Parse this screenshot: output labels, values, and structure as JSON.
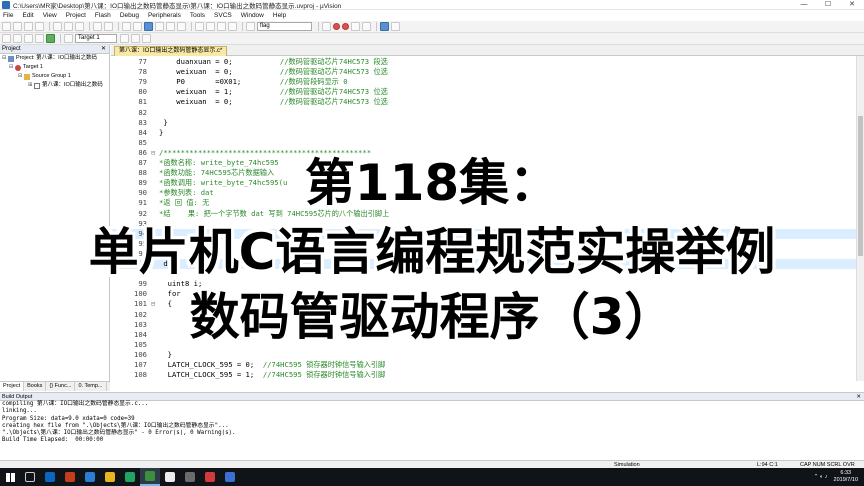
{
  "window": {
    "title": "C:\\Users\\MR家\\Desktop\\第八课：IO口输出之数码管静态显示\\第八课：IO口输出之数码管静态显示.uvproj - µVision"
  },
  "menu": [
    "File",
    "Edit",
    "View",
    "Project",
    "Flash",
    "Debug",
    "Peripherals",
    "Tools",
    "SVCS",
    "Window",
    "Help"
  ],
  "toolbar": {
    "find_text": "flag",
    "target": "Target 1"
  },
  "project": {
    "header": "Project",
    "root": "Project: 第八课：IO口输出之数码",
    "target": "Target 1",
    "group": "Source Group 1",
    "file": "第八课：IO口输出之数码"
  },
  "panel_tabs": [
    "Project",
    "Books",
    "{} Func...",
    "0. Temp..."
  ],
  "editor": {
    "tab": "第八课：IO口输出之数码管静态显示.c*",
    "lines": [
      {
        "n": "77",
        "f": "",
        "code": "    duanxuan = 0;",
        "cmt": "//数码管驱动芯片74HC573 段选"
      },
      {
        "n": "78",
        "f": "",
        "code": "    weixuan  = 0;",
        "cmt": "//数码管驱动芯片74HC573 位选"
      },
      {
        "n": "79",
        "f": "",
        "code": "    P0       =0X01;",
        "cmt": "//数码管段码显示 0"
      },
      {
        "n": "80",
        "f": "",
        "code": "    weixuan  = 1;",
        "cmt": "//数码管驱动芯片74HC573 位选"
      },
      {
        "n": "81",
        "f": "",
        "code": "    weixuan  = 0;",
        "cmt": "//数码管驱动芯片74HC573 位选"
      },
      {
        "n": "82",
        "f": "",
        "code": "",
        "cmt": ""
      },
      {
        "n": "83",
        "f": "",
        "code": " }",
        "cmt": ""
      },
      {
        "n": "84",
        "f": "",
        "code": "}",
        "cmt": ""
      },
      {
        "n": "85",
        "f": "",
        "code": "",
        "cmt": ""
      },
      {
        "n": "86",
        "f": "⊟",
        "code": "",
        "cmt": "/************************************************"
      },
      {
        "n": "87",
        "f": "",
        "code": "",
        "cmt": "*函数名称: write_byte_74hc595"
      },
      {
        "n": "88",
        "f": "",
        "code": "",
        "cmt": "*函数功能: 74HC595芯片数据输入"
      },
      {
        "n": "89",
        "f": "",
        "code": "",
        "cmt": "*函数调用: write_byte_74hc595(u"
      },
      {
        "n": "90",
        "f": "",
        "code": "",
        "cmt": "*参数列表: dat"
      },
      {
        "n": "91",
        "f": "",
        "code": "",
        "cmt": "*返 回 值: 无"
      },
      {
        "n": "92",
        "f": "",
        "code": "",
        "cmt": "*结    果: 把一个字节数 dat 写到 74HC595芯片的八个输出引脚上"
      },
      {
        "n": "93",
        "f": "",
        "code": "",
        "cmt": ""
      },
      {
        "n": "94",
        "f": "",
        "code": "",
        "cmt": ""
      },
      {
        "n": "95",
        "f": "",
        "code": "",
        "cmt": ""
      },
      {
        "n": "96",
        "f": "",
        "code": "",
        "cmt": ""
      },
      {
        "n": "97",
        "f": "",
        "code": " d",
        "cmt": ""
      },
      {
        "n": "98",
        "f": "",
        "code": "",
        "cmt": ""
      },
      {
        "n": "99",
        "f": "",
        "code": "  uint8 i;",
        "cmt": ""
      },
      {
        "n": "100",
        "f": "",
        "code": "  for",
        "cmt": ""
      },
      {
        "n": "101",
        "f": "⊟",
        "code": "  {",
        "cmt": ""
      },
      {
        "n": "102",
        "f": "",
        "code": "",
        "cmt": ""
      },
      {
        "n": "103",
        "f": "",
        "code": "",
        "cmt": ""
      },
      {
        "n": "104",
        "f": "",
        "code": "",
        "cmt": ""
      },
      {
        "n": "105",
        "f": "",
        "code": "",
        "cmt": ""
      },
      {
        "n": "106",
        "f": "",
        "code": "  }",
        "cmt": ""
      },
      {
        "n": "107",
        "f": "",
        "code": "  LATCH_CLOCK_595 = 0;",
        "cmt": "  //74HC595 锁存器时钟信号输入引脚"
      },
      {
        "n": "108",
        "f": "",
        "code": "  LATCH_CLOCK_595 = 1;",
        "cmt": "  //74HC595 锁存器时钟信号输入引脚"
      },
      {
        "n": "109",
        "f": "",
        "code": "}",
        "cmt": ""
      }
    ]
  },
  "overlay": {
    "line1": "第118集：",
    "line2": "单片机C语言编程规范实操举例",
    "line3": "数码管驱动程序（3）"
  },
  "build": {
    "header": "Build Output",
    "lines": [
      "compiling 第八课：IO口输出之数码管静态显示.c...",
      "linking...",
      "Program Size: data=9.0 xdata=0 code=39",
      "creating hex file from \".\\Objects\\第八课：IO口输出之数码管静态显示\"...",
      "\".\\Objects\\第八课：IO口输出之数码管静态显示\" - 0 Error(s), 0 Warning(s).",
      "Build Time Elapsed:  00:00:00"
    ]
  },
  "status": {
    "mode": "Simulation",
    "position": "L:94 C:1",
    "flags": "CAP  NUM  SCRL  OVR  R/W"
  },
  "taskbar": {
    "time": "6:33",
    "date": "2019/7/10"
  }
}
